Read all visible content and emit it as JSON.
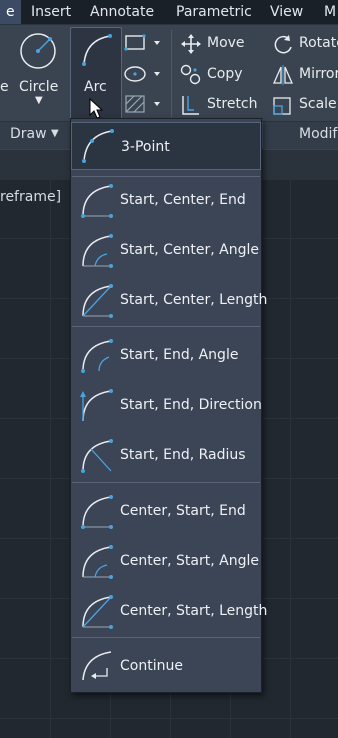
{
  "menubar": {
    "tabs": [
      "e",
      "Insert",
      "Annotate",
      "Parametric",
      "View",
      "M"
    ]
  },
  "ribbon": {
    "circle_label": "Circle",
    "arc_label": "Arc",
    "draw_panel_label": "Draw",
    "modify_panel_label": "Modif",
    "modify_tools": {
      "move": "Move",
      "rotate": "Rotate",
      "copy": "Copy",
      "mirror": "Mirror",
      "stretch": "Stretch",
      "scale": "Scale"
    }
  },
  "viewport": {
    "style_label": "reframe]"
  },
  "arc_menu": {
    "items": [
      {
        "label": "3-Point",
        "icon": "arc-3point-icon"
      },
      {
        "label": "Start, Center, End",
        "icon": "arc-start-center-end-icon"
      },
      {
        "label": "Start, Center, Angle",
        "icon": "arc-start-center-angle-icon"
      },
      {
        "label": "Start, Center, Length",
        "icon": "arc-start-center-length-icon"
      },
      {
        "label": "Start, End, Angle",
        "icon": "arc-start-end-angle-icon"
      },
      {
        "label": "Start, End, Direction",
        "icon": "arc-start-end-direction-icon"
      },
      {
        "label": "Start, End, Radius",
        "icon": "arc-start-end-radius-icon"
      },
      {
        "label": "Center, Start, End",
        "icon": "arc-center-start-end-icon"
      },
      {
        "label": "Center, Start, Angle",
        "icon": "arc-center-start-angle-icon"
      },
      {
        "label": "Center, Start, Length",
        "icon": "arc-center-start-length-icon"
      },
      {
        "label": "Continue",
        "icon": "arc-continue-icon"
      }
    ]
  },
  "colors": {
    "accent_blue": "#4aa3e0",
    "menu_bg": "#3b4555",
    "ribbon_bg": "#3a4450"
  }
}
